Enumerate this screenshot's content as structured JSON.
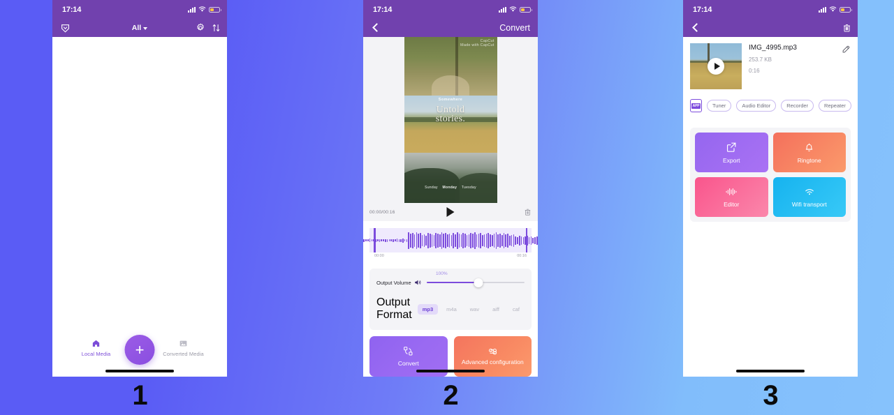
{
  "background": {
    "from": "#5a5cf5",
    "to": "#86c2fc"
  },
  "captions": [
    "1",
    "2",
    "3"
  ],
  "theme": {
    "nav_purple": "#7141ae",
    "accent_purple": "#7c4bdd",
    "tile_export": "#9566ef",
    "tile_ringtone": "#f4705c",
    "tile_editor": "#f9558c",
    "tile_wifi": "#16b3ef"
  },
  "status_bar": {
    "time": "17:14",
    "icons": [
      "signal-bars-icon",
      "wifi-icon",
      "battery-low-icon"
    ],
    "battery_fill_color": "#f9c642"
  },
  "screen1": {
    "nav": {
      "left_icon": "shield-heart-icon",
      "filter_label": "All",
      "filter_caret": "chevron-down-icon",
      "right_icons": [
        "gear-icon",
        "sort-icon"
      ]
    },
    "content_empty": true,
    "tabbar": {
      "tabs": [
        {
          "label": "Local Media",
          "icon": "home-icon",
          "active": true
        },
        {
          "label": "Converted Media",
          "icon": "image-icon",
          "active": false
        }
      ],
      "fab": {
        "label": "+",
        "name": "add-media-button"
      }
    }
  },
  "screen2": {
    "nav": {
      "back_icon": "chevron-left-icon",
      "title": "Convert"
    },
    "video": {
      "overlay_top": "Somewhere",
      "overlay_mid_line1": "Untold",
      "overlay_mid_line2": "stories.",
      "overlay_bottom": [
        "Sunday",
        "Monday",
        "Tuesday"
      ],
      "watermark_line1": "CapCut",
      "watermark_line2": "Made with CapCut"
    },
    "player": {
      "timecode": "00:00/00:16",
      "play_icon": "play-icon",
      "delete_icon": "trash-icon"
    },
    "waveform": {
      "start_label": "00:00",
      "end_label": "00:16",
      "bars": [
        4,
        2,
        1,
        12,
        4,
        4,
        3,
        3,
        5,
        3,
        3,
        4,
        3,
        4,
        3,
        3,
        4,
        4,
        3,
        3,
        4,
        3,
        5,
        4,
        4,
        6,
        3,
        4,
        24,
        20,
        22,
        18,
        24,
        20,
        22,
        16,
        18,
        14,
        22,
        20,
        18,
        16,
        22,
        20,
        18,
        24,
        20,
        22,
        18,
        20,
        16,
        22,
        18,
        24,
        20,
        18,
        22,
        20,
        16,
        18,
        22,
        20,
        24,
        18,
        20,
        22,
        16,
        18,
        20,
        22,
        18,
        16,
        20,
        24,
        18,
        20,
        16,
        22,
        18,
        20,
        14,
        16,
        18,
        12,
        10,
        14,
        12,
        10,
        12,
        14,
        10,
        12,
        8,
        10,
        12,
        8,
        10,
        6,
        8,
        6
      ],
      "left_handle": "trim-start-handle",
      "right_handle": "trim-end-handle"
    },
    "settings": {
      "volume_label": "Output Volume",
      "volume_icon": "speaker-icon",
      "volume_value": "100%",
      "volume_percent": 53,
      "format_label": "Output Format",
      "formats": [
        {
          "label": "mp3",
          "selected": true
        },
        {
          "label": "m4a",
          "selected": false
        },
        {
          "label": "wav",
          "selected": false
        },
        {
          "label": "aiff",
          "selected": false
        },
        {
          "label": "caf",
          "selected": false
        }
      ]
    },
    "actions": [
      {
        "label": "Convert",
        "icon": "convert-icon",
        "style": "purple"
      },
      {
        "label": "Advanced configuration",
        "icon": "infinity-icon",
        "style": "orange"
      }
    ]
  },
  "screen3": {
    "nav": {
      "back_icon": "chevron-left-icon",
      "delete_icon": "trash-icon"
    },
    "file": {
      "name": "IMG_4995.mp3",
      "size": "253.7 KB",
      "duration": "0:16",
      "play_icon": "play-circle-icon",
      "edit_icon": "pencil-icon"
    },
    "chips": {
      "app_icon": "app-phone-icon",
      "app_icon_text": "APP",
      "items": [
        "Tuner",
        "Audio Editor",
        "Recorder",
        "Repeater"
      ]
    },
    "tiles": [
      {
        "label": "Export",
        "icon": "export-icon",
        "style": "t-export"
      },
      {
        "label": "Ringtone",
        "icon": "bell-icon",
        "style": "t-ringtone"
      },
      {
        "label": "Editor",
        "icon": "waveform-icon",
        "style": "t-editor"
      },
      {
        "label": "Wifi transport",
        "icon": "wifi-icon",
        "style": "t-wifi"
      }
    ]
  }
}
